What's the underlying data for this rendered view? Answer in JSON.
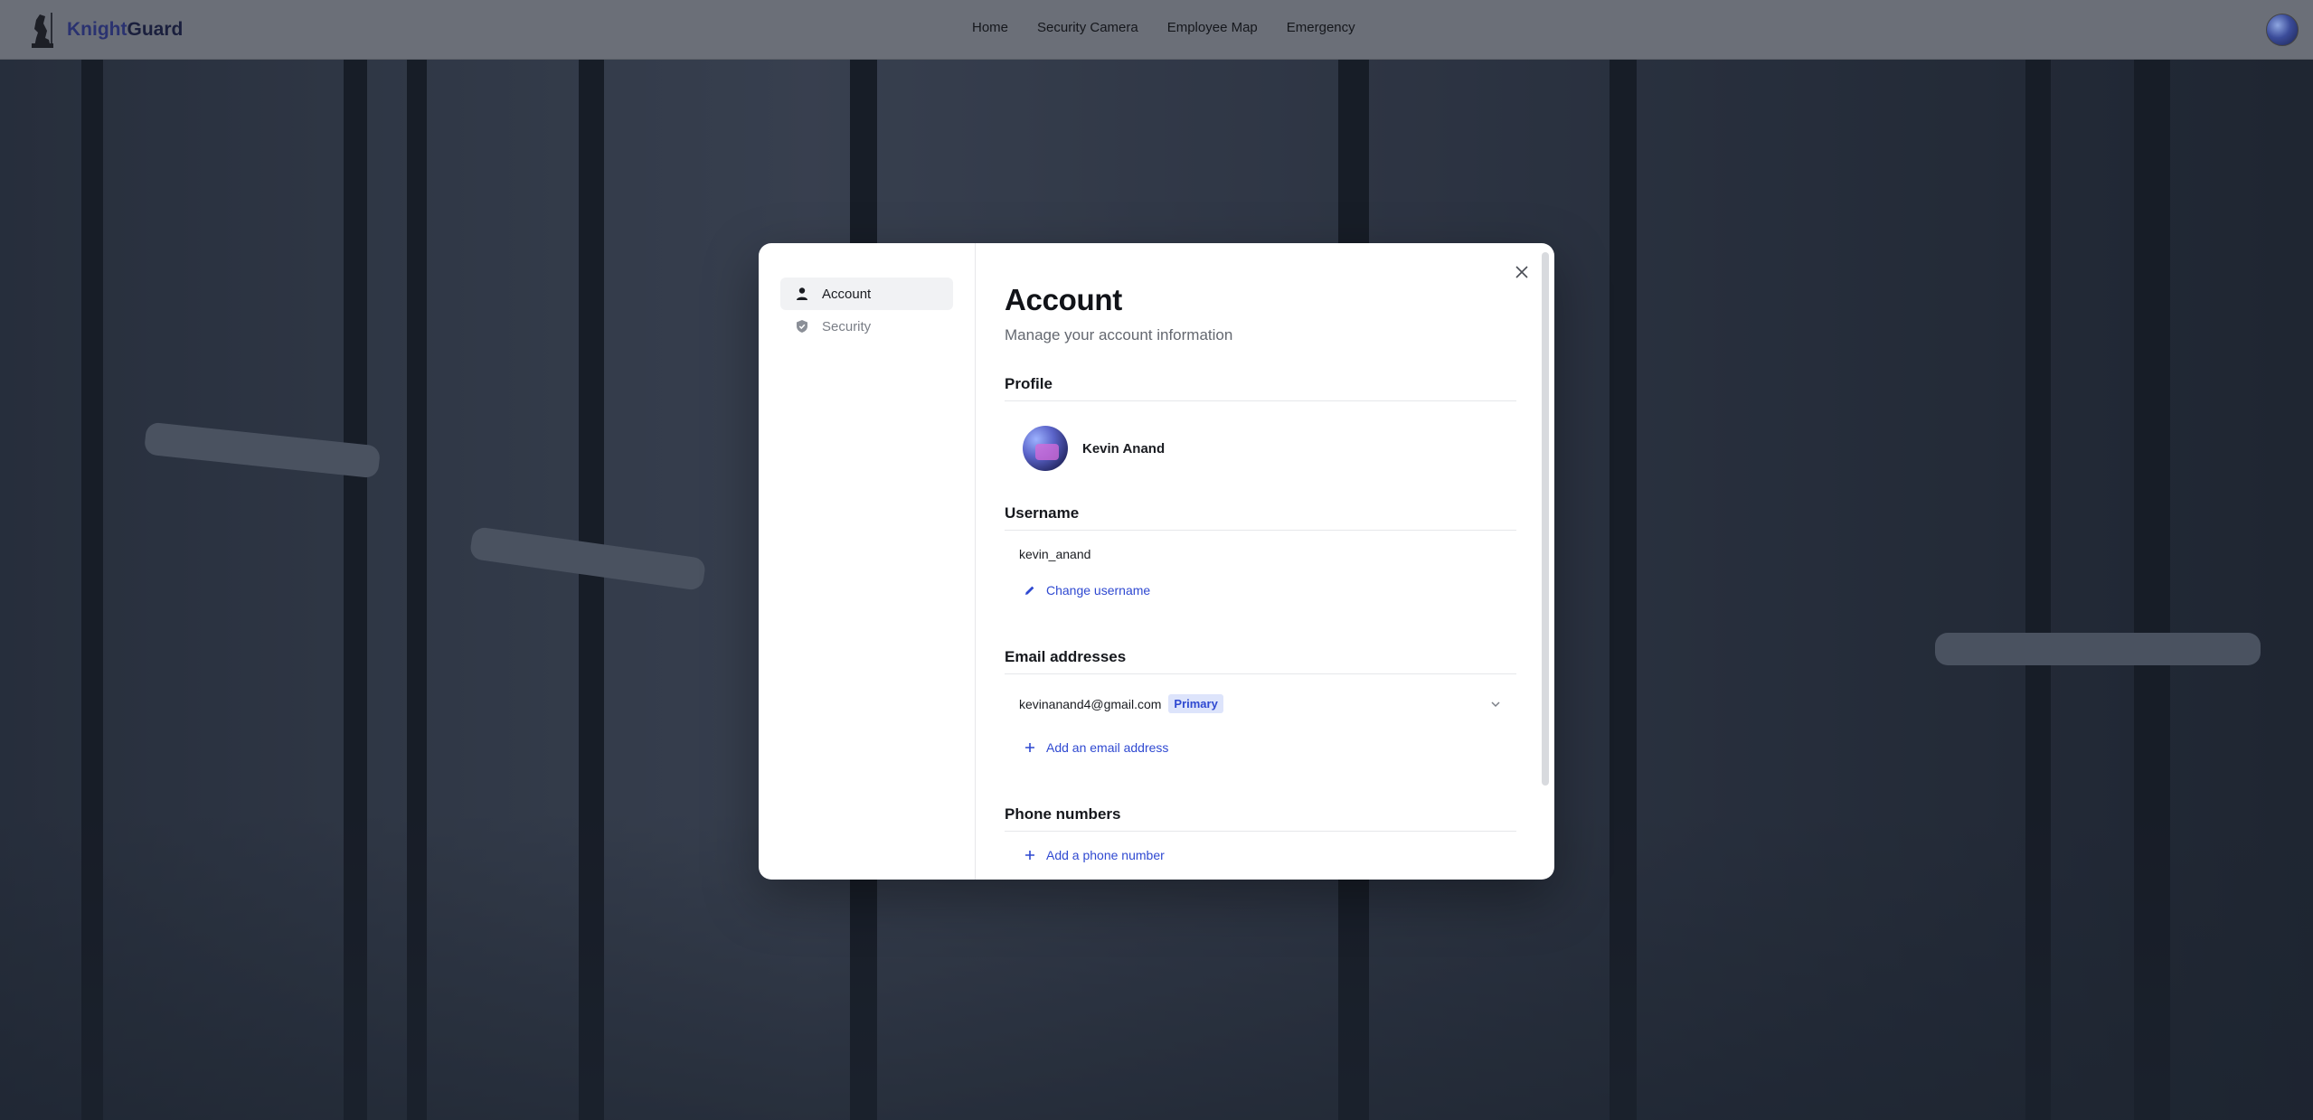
{
  "app": {
    "brand_first": "Knight",
    "brand_second": "Guard"
  },
  "nav": {
    "links": [
      "Home",
      "Security Camera",
      "Employee Map",
      "Emergency"
    ]
  },
  "modal": {
    "sidebar": {
      "items": [
        {
          "label": "Account",
          "icon": "person-icon",
          "active": true
        },
        {
          "label": "Security",
          "icon": "shield-icon",
          "active": false
        }
      ]
    },
    "title": "Account",
    "subtitle": "Manage your account information",
    "profile": {
      "heading": "Profile",
      "name": "Kevin Anand"
    },
    "username": {
      "heading": "Username",
      "value": "kevin_anand",
      "action": "Change username"
    },
    "emails": {
      "heading": "Email addresses",
      "items": [
        {
          "address": "kevinanand4@gmail.com",
          "badge": "Primary"
        }
      ],
      "action": "Add an email address"
    },
    "phones": {
      "heading": "Phone numbers",
      "action": "Add a phone number"
    }
  },
  "colors": {
    "link": "#2f49d1",
    "badge_bg": "#dde4fb",
    "navbar_bg": "#6b6f78"
  }
}
